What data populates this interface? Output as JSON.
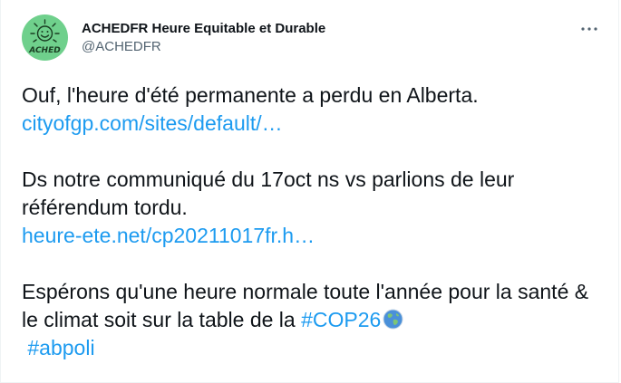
{
  "tweet": {
    "author": {
      "display_name": "ACHEDFR Heure Equitable et Durable",
      "handle": "@ACHEDFR",
      "avatar_text": "ACHED",
      "avatar_color": "#6fd08c"
    },
    "more_icon": "more-horizontal-icon",
    "link_color": "#1d9bf0",
    "paragraphs": {
      "p1_text": "Ouf, l'heure d'été permanente a perdu en Alberta.",
      "p1_link": "cityofgp.com/sites/default/…",
      "p2_text": "Ds notre communiqué du 17oct ns vs parlions de leur référendum tordu.",
      "p2_link": "heure-ete.net/cp20211017fr.h…",
      "p3_text": "Espérons qu'une heure normale toute l'année pour la santé & le climat soit sur la table de la ",
      "p3_hashtag1": "#COP26",
      "p3_emoji": "earth-globe-icon",
      "p3_hashtag2": "#abpoli"
    }
  }
}
